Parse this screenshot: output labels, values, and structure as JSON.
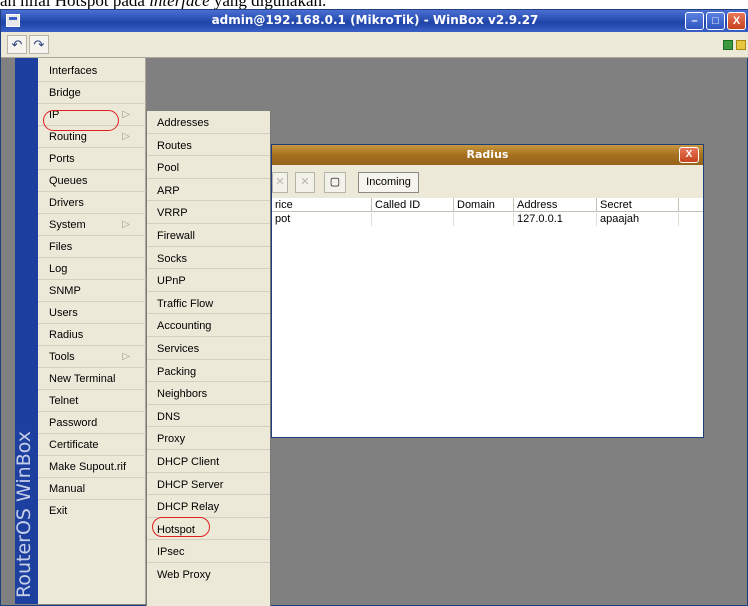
{
  "document": {
    "text_before": "an nilai Hotspot pada ",
    "text_italic": "interface",
    "text_after": " yang digunakan."
  },
  "window": {
    "title": "admin@192.168.0.1 (MikroTik) - WinBox v2.9.27",
    "minimize_label": "–",
    "maximize_label": "□",
    "close_label": "X"
  },
  "toolbar": {
    "undo_label": "↶",
    "redo_label": "↷"
  },
  "colors": {
    "brand_strip": "#1c3fa0",
    "radius_title": "#a5701f",
    "highlight_ring": "#e02020"
  },
  "brand": {
    "text": "RouterOS WinBox"
  },
  "main_menu": {
    "items": [
      {
        "label": "Interfaces",
        "arrow": ""
      },
      {
        "label": "Bridge",
        "arrow": ""
      },
      {
        "label": "IP",
        "arrow": "▷"
      },
      {
        "label": "Routing",
        "arrow": "▷"
      },
      {
        "label": "Ports",
        "arrow": ""
      },
      {
        "label": "Queues",
        "arrow": ""
      },
      {
        "label": "Drivers",
        "arrow": ""
      },
      {
        "label": "System",
        "arrow": "▷"
      },
      {
        "label": "Files",
        "arrow": ""
      },
      {
        "label": "Log",
        "arrow": ""
      },
      {
        "label": "SNMP",
        "arrow": ""
      },
      {
        "label": "Users",
        "arrow": ""
      },
      {
        "label": "Radius",
        "arrow": ""
      },
      {
        "label": "Tools",
        "arrow": "▷"
      },
      {
        "label": "New Terminal",
        "arrow": ""
      },
      {
        "label": "Telnet",
        "arrow": ""
      },
      {
        "label": "Password",
        "arrow": ""
      },
      {
        "label": "Certificate",
        "arrow": ""
      },
      {
        "label": "Make Supout.rif",
        "arrow": ""
      },
      {
        "label": "Manual",
        "arrow": ""
      },
      {
        "label": "Exit",
        "arrow": ""
      }
    ]
  },
  "ip_submenu": {
    "items": [
      "Addresses",
      "Routes",
      "Pool",
      "ARP",
      "VRRP",
      "Firewall",
      "Socks",
      "UPnP",
      "Traffic Flow",
      "Accounting",
      "Services",
      "Packing",
      "Neighbors",
      "DNS",
      "Proxy",
      "DHCP Client",
      "DHCP Server",
      "DHCP Relay",
      "Hotspot",
      "IPsec",
      "Web Proxy"
    ]
  },
  "radius_window": {
    "title": "Radius",
    "close_label": "X",
    "incoming_label": "Incoming",
    "tool_remove": "✕",
    "tool_disable": "✕",
    "tool_comment": "▢",
    "columns": [
      "rice",
      "Called ID",
      "Domain",
      "Address",
      "Secret"
    ],
    "rows": [
      {
        "service": "pot",
        "called_id": "",
        "domain": "",
        "address": "127.0.0.1",
        "secret": "apaajah"
      }
    ]
  }
}
